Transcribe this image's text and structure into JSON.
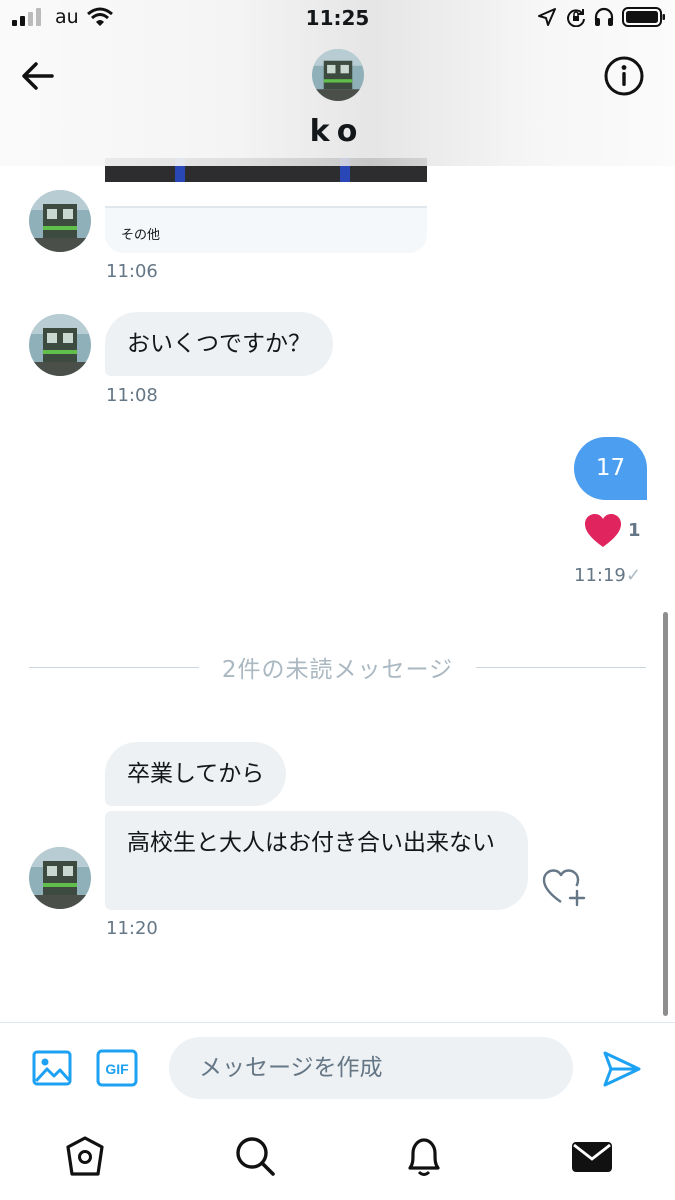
{
  "status_bar": {
    "carrier": "au",
    "time": "11:25"
  },
  "header": {
    "name": "ko"
  },
  "messages": {
    "card_label": "その他",
    "time_1": "11:06",
    "msg_2": "おいくつですか？",
    "time_2": "11:08",
    "out_msg": "17",
    "out_like_count": "1",
    "out_time": "11:19",
    "out_check": "✓",
    "unread_divider": "2件の未読メッセージ",
    "msg_3": "卒業してから",
    "msg_4": "高校生と大人はお付き合い出来ない",
    "time_4": "11:20"
  },
  "composer": {
    "placeholder": "メッセージを作成",
    "gif_label": "GIF"
  },
  "colors": {
    "accent": "#1da1f2",
    "outgoing_bubble": "#4c9ef1",
    "incoming_bubble": "#eef1f3",
    "heart": "#e0245e"
  },
  "icons": [
    "back-arrow-icon",
    "info-icon",
    "heart-icon",
    "heart-add-icon",
    "image-icon",
    "gif-icon",
    "send-icon",
    "home-icon",
    "search-icon",
    "bell-icon",
    "mail-icon"
  ]
}
